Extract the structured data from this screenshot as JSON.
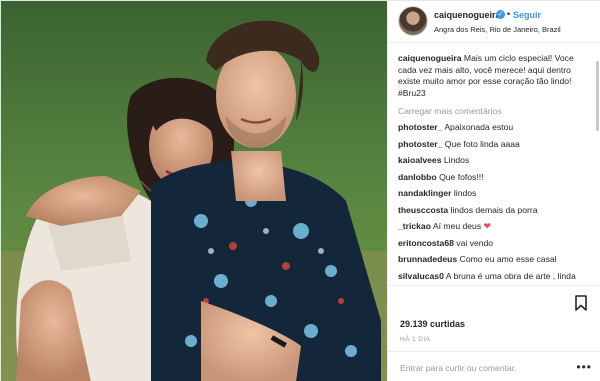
{
  "post": {
    "username": "caiquenogueira",
    "follow_label": "Seguir",
    "separator": "•",
    "location": "Angra dos Reis, Rio de Janeiro, Brazil",
    "caption_user": "caiquenogueira",
    "caption_text": "Mais um ciclo especial! Voce cada vez mais alto, você merece! aqui dentro existe muito amor por esse coração tão lindo! #Bru23",
    "load_more": "Carregar mais comentários",
    "comments": [
      {
        "user": "photoster_",
        "text": "Apaixonada estou"
      },
      {
        "user": "photoster_",
        "text": "Que foto linda aaaa"
      },
      {
        "user": "kaioalvees",
        "text": "Lindos"
      },
      {
        "user": "danlobbo",
        "text": "Que fofos!!!"
      },
      {
        "user": "nandaklinger",
        "text": "lindos"
      },
      {
        "user": "theusccosta",
        "text": "lindos demais da porra"
      },
      {
        "user": "_trickao",
        "text": "Aí meu deus",
        "emoji": "❤"
      },
      {
        "user": "eritoncosta68",
        "text": "vai vendo"
      },
      {
        "user": "brunnadedeus",
        "text": "Como eu amo esse casal"
      },
      {
        "user": "silvalucas0",
        "text": "A bruna é uma obra de arte , linda demais",
        "emoji": "♥♥♥"
      }
    ],
    "likes": "29.139 curtidas",
    "time": "HÁ 1 DIA",
    "comment_placeholder": "Entrar para curtir ou comentar.",
    "more_options": "•••"
  },
  "colors": {
    "accent": "#3897f0",
    "like_red": "#ed4956",
    "muted": "#999999"
  },
  "icons": {
    "verified": "verified-badge-icon",
    "bookmark": "bookmark-icon",
    "more": "more-options-icon"
  }
}
